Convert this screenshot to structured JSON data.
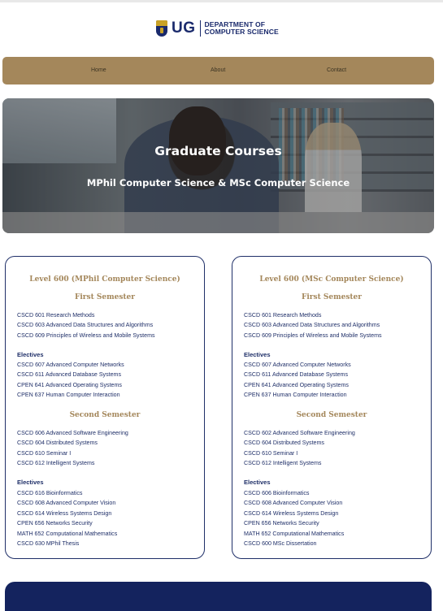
{
  "brand": {
    "logo_text": "UG",
    "dept_line1": "DEPARTMENT OF",
    "dept_line2": "COMPUTER SCIENCE"
  },
  "nav": {
    "items": [
      "Home",
      "About",
      "Contact"
    ]
  },
  "hero": {
    "title": "Graduate Courses",
    "subtitle": "MPhil Computer Science & MSc Computer Science"
  },
  "cards": [
    {
      "level": "Level 600 (MPhil Computer Science)",
      "first_semester": "First Semester",
      "first_core": [
        "CSCD 601 Research Methods",
        "CSCD 603 Advanced Data Structures and Algorithms",
        "CSCD 609 Principles of Wireless and Mobile Systems"
      ],
      "electives_label_1": "Electives",
      "first_electives": [
        "CSCD 607 Advanced Computer Networks",
        "CSCD 611 Advanced Database Systems",
        "CPEN 641 Advanced Operating Systems",
        "CPEN 637 Human Computer Interaction"
      ],
      "second_semester": "Second Semester",
      "second_core": [
        "CSCD 606 Advanced Software Engineering",
        "CSCD 604 Distributed Systems",
        "CSCD 610 Seminar I",
        "CSCD 612 Intelligent Systems"
      ],
      "electives_label_2": "Electives",
      "second_electives": [
        "CSCD 616 Bioinformatics",
        "CSCD 608 Advanced Computer Vision",
        "CSCD 614 Wireless Systems Design",
        "CPEN 656 Networks Security",
        "MATH 652 Computational Mathematics",
        "CSCD 630 MPhil Thesis"
      ]
    },
    {
      "level": "Level 600 (MSc Computer Science)",
      "first_semester": "First Semester",
      "first_core": [
        "CSCD 601 Research Methods",
        "CSCD 603 Advanced Data Structures and Algorithms",
        "CSCD 609 Principles of Wireless and Mobile Systems"
      ],
      "electives_label_1": "Electives",
      "first_electives": [
        "CSCD 607 Advanced Computer Networks",
        "CSCD 611 Advanced Database Systems",
        "CPEN 641 Advanced Operating Systems",
        "CPEN 637 Human Computer Interaction"
      ],
      "second_semester": "Second Semester",
      "second_core": [
        "CSCD 602 Advanced Software Engineering",
        "CSCD 604 Distributed Systems",
        "CSCD 610 Seminar I",
        "CSCD 612 Intelligent Systems"
      ],
      "electives_label_2": "Electives",
      "second_electives": [
        "CSCD 606 Bioinformatics",
        "CSCD 608 Advanced Computer Vision",
        "CSCD 614 Wireless Systems Design",
        "CPEN 656 Networks Security",
        "MATH 652 Computational Mathematics",
        "CSCD 600 MSc Dissertation"
      ]
    }
  ],
  "colors": {
    "accent_gold": "#a4875b",
    "navy": "#1f2f68",
    "footer": "#14235e"
  }
}
